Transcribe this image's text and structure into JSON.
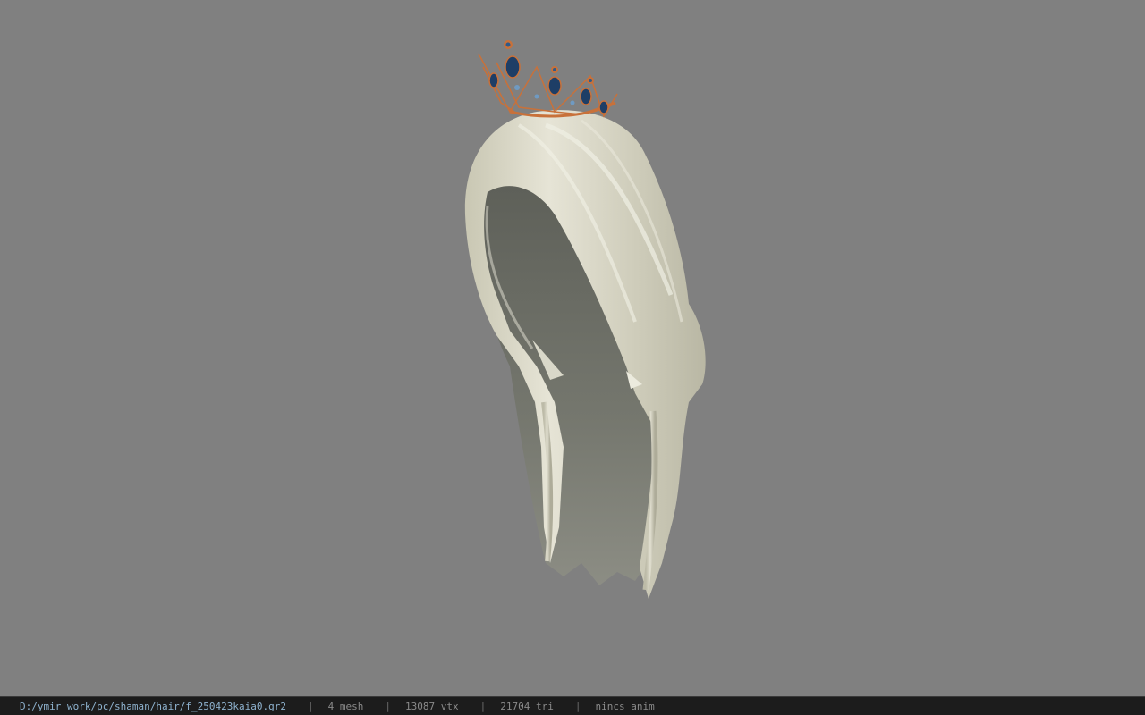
{
  "viewport": {
    "background_color": "#808080",
    "model_icon": "hair-with-crown-model",
    "hair_color": "#d8d6c4",
    "crown_gold_color": "#c8713a",
    "crown_gem_color": "#1e3e66"
  },
  "statusbar": {
    "file_path": "D:/ymir work/pc/shaman/hair/f_250423kaia0.gr2",
    "separator": "|",
    "mesh_count": "4 mesh",
    "vertex_count": "13087 vtx",
    "triangle_count": "21704 tri",
    "anim_status": "nincs anim"
  }
}
